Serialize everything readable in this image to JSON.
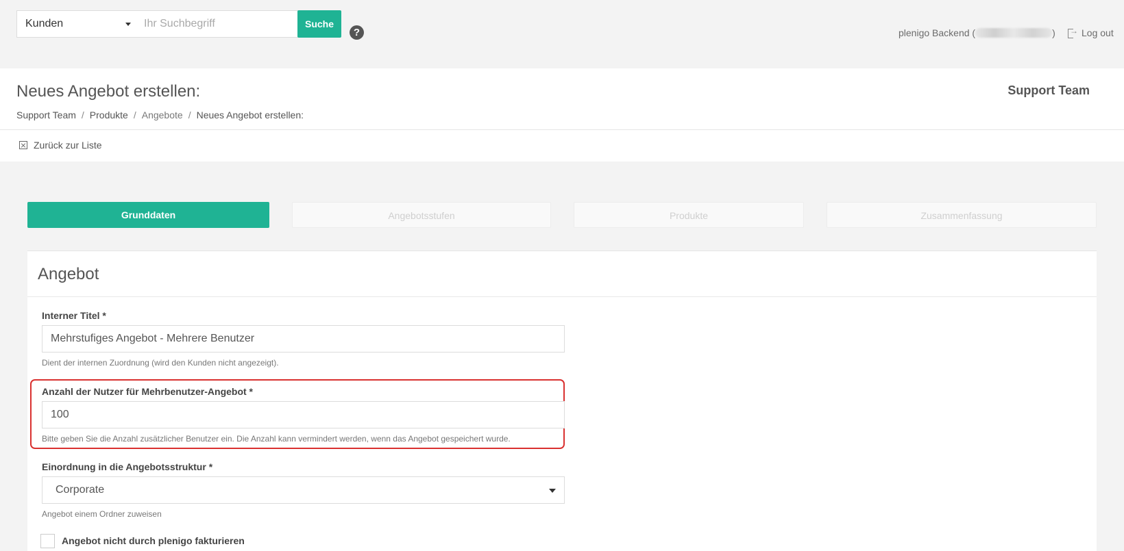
{
  "search": {
    "type_value": "Kunden",
    "placeholder": "Ihr Suchbegriff",
    "button_label": "Suche"
  },
  "user": {
    "backend_label": "plenigo Backend (",
    "backend_close": ")",
    "logout_label": "Log out"
  },
  "header": {
    "title": "Neues Angebot erstellen:",
    "team": "Support Team",
    "breadcrumb": [
      "Support Team",
      "Produkte",
      "Angebote",
      "Neues Angebot erstellen:"
    ],
    "breadcrumb_sep": "/",
    "back_label": "Zurück zur Liste"
  },
  "steps": [
    "Grunddaten",
    "Angebotsstufen",
    "Produkte",
    "Zusammenfassung"
  ],
  "form": {
    "title": "Angebot",
    "internal_title": {
      "label": "Interner Titel *",
      "value": "Mehrstufiges Angebot - Mehrere Benutzer",
      "help": "Dient der internen Zuordnung (wird den Kunden nicht angezeigt)."
    },
    "user_count": {
      "label": "Anzahl der Nutzer für Mehrbenutzer-Angebot *",
      "value": "100",
      "help": "Bitte geben Sie die Anzahl zusätzlicher Benutzer ein. Die Anzahl kann vermindert werden, wenn das Angebot gespeichert wurde."
    },
    "structure": {
      "label": "Einordnung in die Angebotsstruktur *",
      "value": "Corporate",
      "help": "Angebot einem Ordner zuweisen"
    },
    "no_billing": {
      "label": "Angebot nicht durch plenigo fakturieren"
    }
  },
  "colors": {
    "accent": "#1fb394",
    "highlight": "#d9302f"
  }
}
